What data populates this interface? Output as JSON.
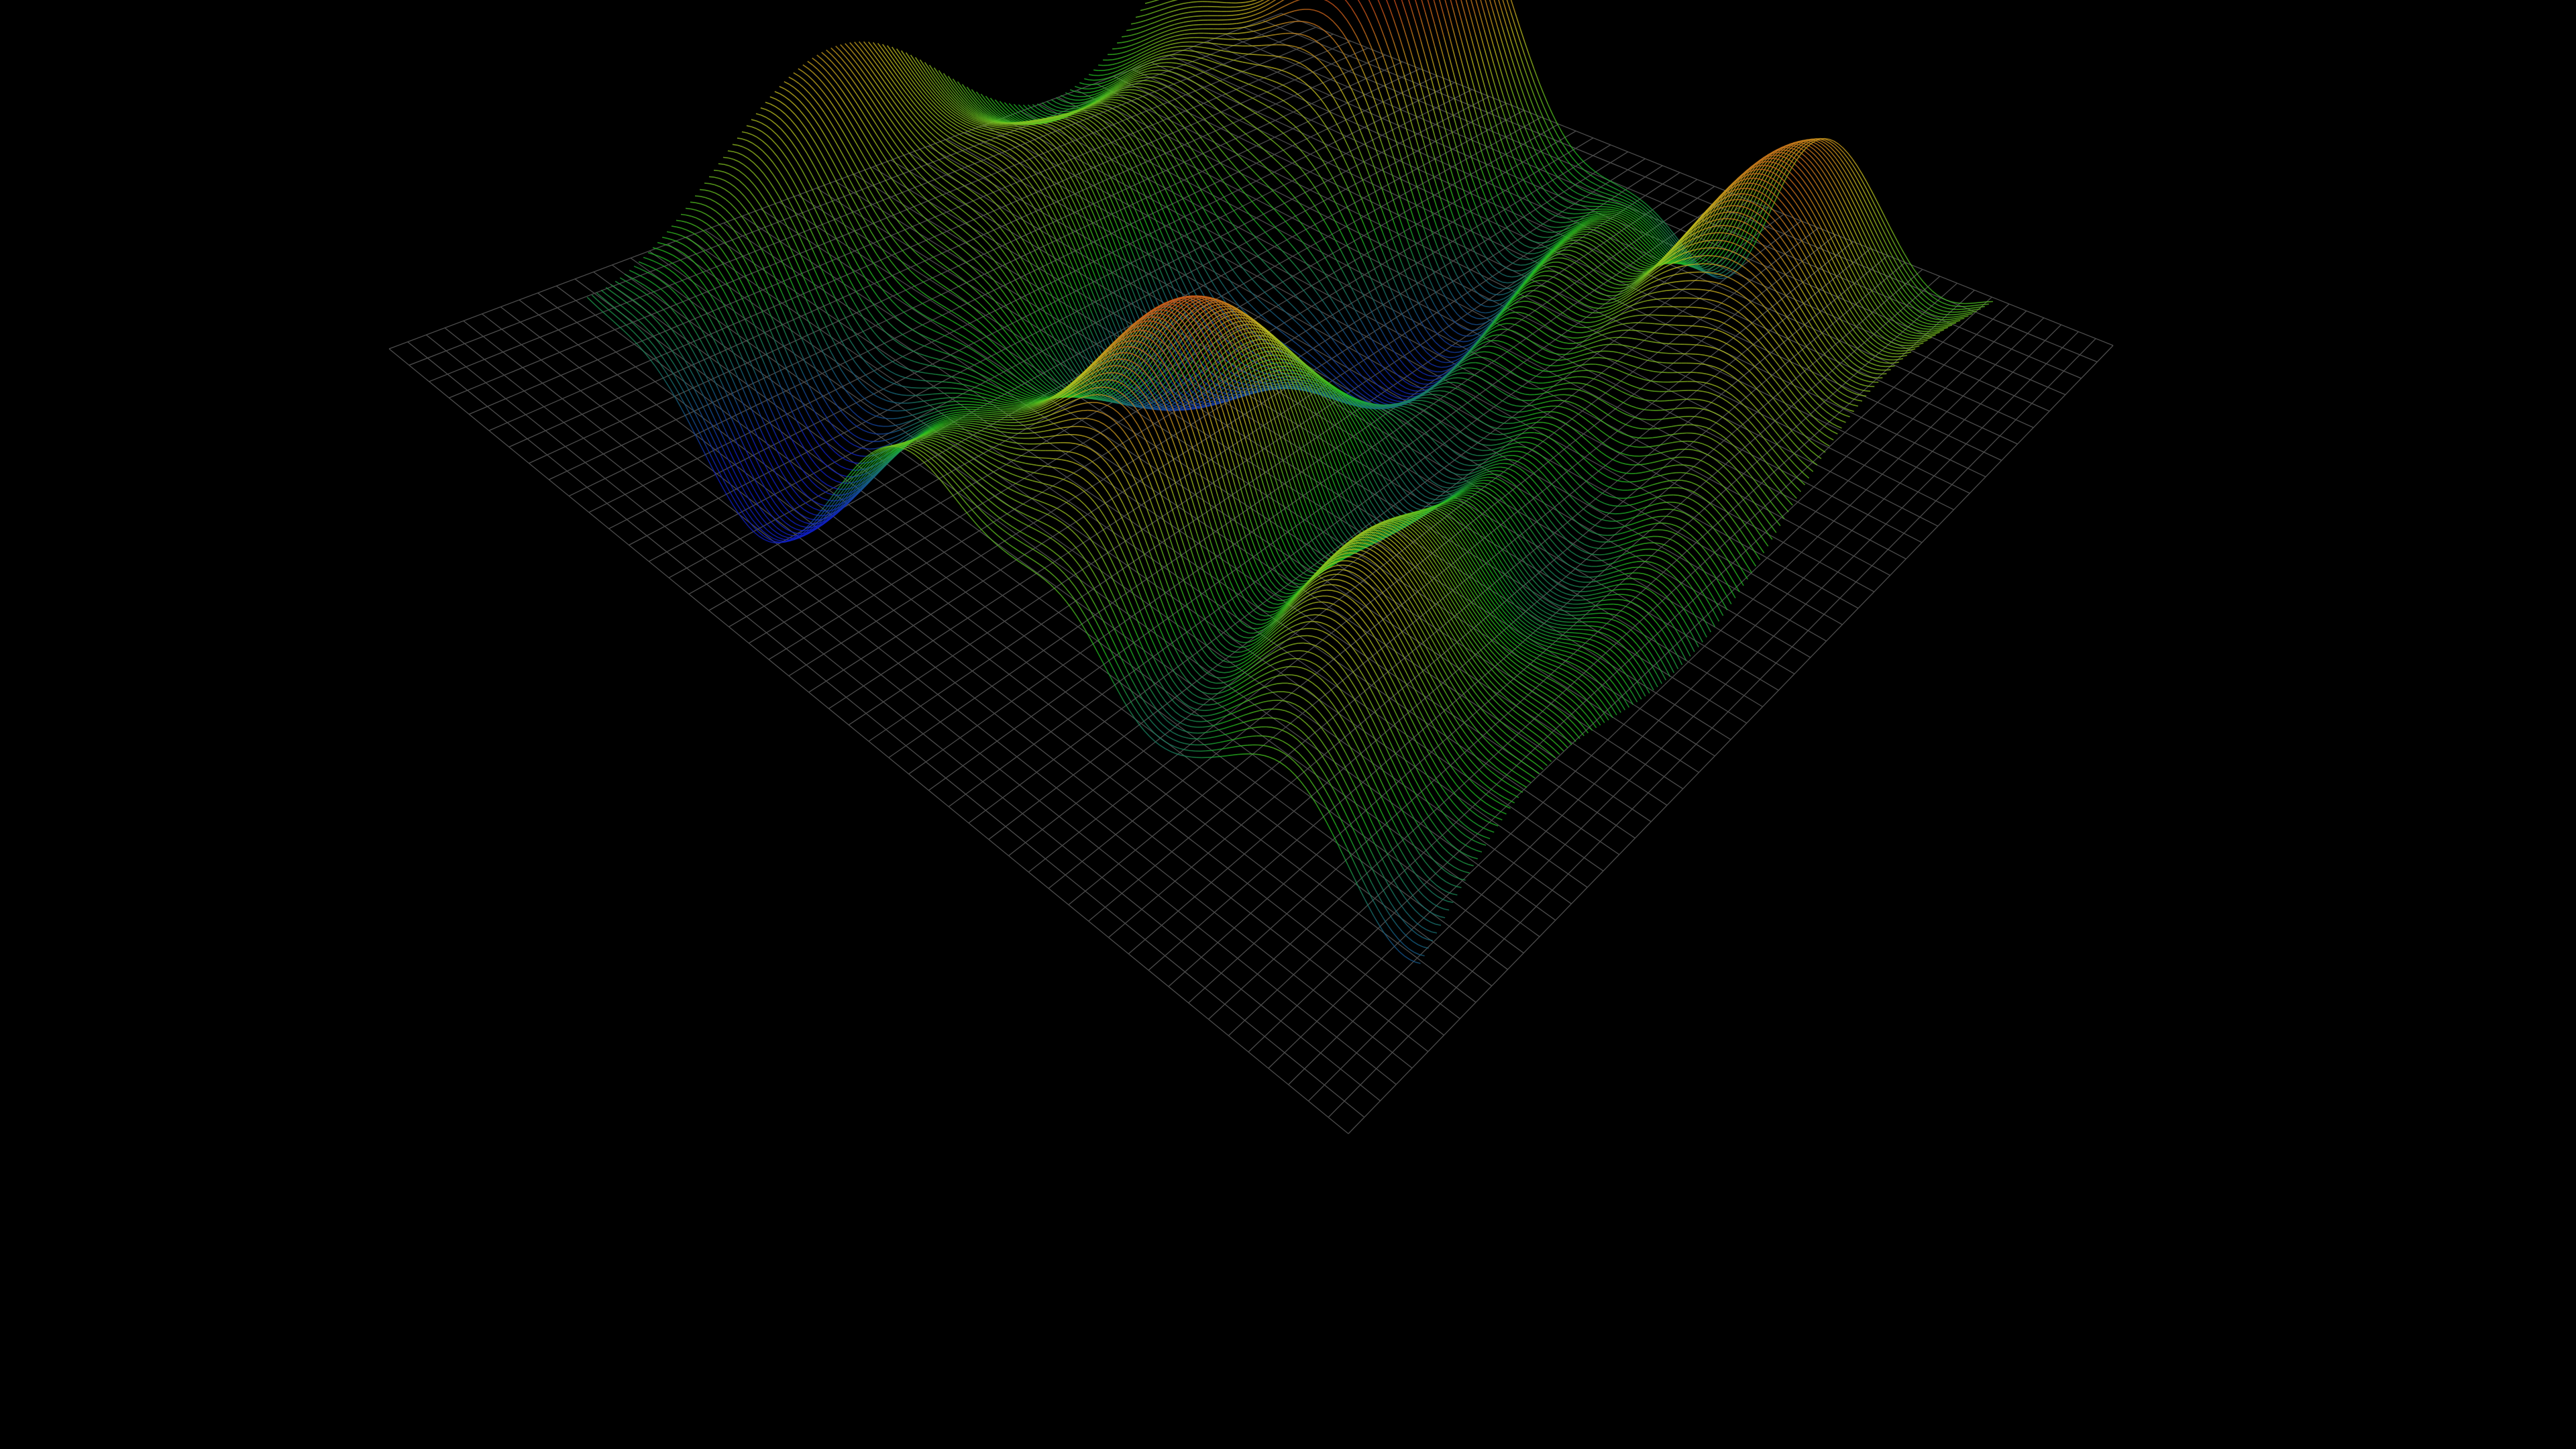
{
  "scene": {
    "kind": "3d-terrain-point-cloud",
    "background_color": "#000000",
    "grid_color": "#8a8a8a",
    "grid_lines": 48,
    "colormap": {
      "low": "#1020c8",
      "mid_low": "#20c020",
      "mid": "#c8c020",
      "high": "#d81818"
    }
  }
}
